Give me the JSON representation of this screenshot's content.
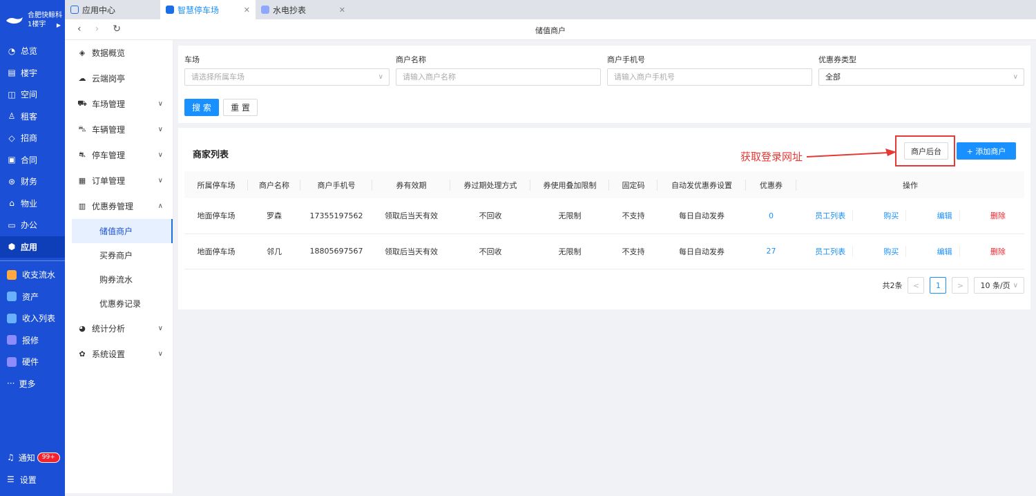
{
  "brand": {
    "line1": "合肥快鲸科",
    "line2": "1楼宇"
  },
  "left_nav": [
    {
      "label": "总览",
      "icon": "◔"
    },
    {
      "label": "楼宇",
      "icon": "▤"
    },
    {
      "label": "空间",
      "icon": "◫"
    },
    {
      "label": "租客",
      "icon": "♙"
    },
    {
      "label": "招商",
      "icon": "◇"
    },
    {
      "label": "合同",
      "icon": "▣"
    },
    {
      "label": "财务",
      "icon": "⊛"
    },
    {
      "label": "物业",
      "icon": "⌂"
    },
    {
      "label": "办公",
      "icon": "▭"
    },
    {
      "label": "应用",
      "icon": "⬢"
    }
  ],
  "quick_nav": [
    {
      "label": "收支流水",
      "color": "#ffa940"
    },
    {
      "label": "资产",
      "color": "#69b1ff"
    },
    {
      "label": "收入列表",
      "color": "#69b1ff"
    },
    {
      "label": "报修",
      "color": "#8c8cff"
    },
    {
      "label": "硬件",
      "color": "#8c8cff"
    }
  ],
  "more_label": "更多",
  "notify": {
    "label": "通知",
    "badge": "99+"
  },
  "settings_label": "设置",
  "tabs": [
    {
      "label": "应用中心"
    },
    {
      "label": "智慧停车场"
    },
    {
      "label": "水电抄表"
    }
  ],
  "page_title": "储值商户",
  "side_menu": {
    "items_top": [
      {
        "label": "数据概览",
        "icon": "◈"
      },
      {
        "label": "云端岗亭",
        "icon": "☁"
      },
      {
        "label": "车场管理",
        "icon": "⛟"
      },
      {
        "label": "车辆管理",
        "icon": "⛍"
      },
      {
        "label": "停车管理",
        "icon": "⛐"
      },
      {
        "label": "订单管理",
        "icon": "▦"
      },
      {
        "label": "优惠券管理",
        "icon": "▥"
      }
    ],
    "sub_items": [
      "储值商户",
      "买券商户",
      "购券流水",
      "优惠券记录"
    ],
    "items_bottom": [
      {
        "label": "统计分析",
        "icon": "◕"
      },
      {
        "label": "系统设置",
        "icon": "✿"
      }
    ]
  },
  "filter": {
    "lot_label": "车场",
    "lot_placeholder": "请选择所属车场",
    "name_label": "商户名称",
    "name_placeholder": "请输入商户名称",
    "phone_label": "商户手机号",
    "phone_placeholder": "请输入商户手机号",
    "type_label": "优惠券类型",
    "type_value": "全部",
    "search_btn": "搜 索",
    "reset_btn": "重 置"
  },
  "list": {
    "title": "商家列表",
    "annotation": "获取登录网址",
    "backend_btn": "商户后台",
    "add_btn": "+ 添加商户",
    "columns": [
      "所属停车场",
      "商户名称",
      "商户手机号",
      "券有效期",
      "券过期处理方式",
      "券使用叠加限制",
      "固定码",
      "自动发优惠券设置",
      "优惠券",
      "操作"
    ],
    "rows": [
      {
        "lot": "地面停车场",
        "name": "罗森",
        "phone": "17355197562",
        "validity": "领取后当天有效",
        "expire": "不回收",
        "stack": "无限制",
        "fixed": "不支持",
        "auto": "每日自动发券",
        "coupons": "0"
      },
      {
        "lot": "地面停车场",
        "name": "邻几",
        "phone": "18805697567",
        "validity": "领取后当天有效",
        "expire": "不回收",
        "stack": "无限制",
        "fixed": "不支持",
        "auto": "每日自动发券",
        "coupons": "27"
      }
    ],
    "ops": [
      "员工列表",
      "购买",
      "编辑",
      "删除"
    ]
  },
  "pager": {
    "total": "共2条",
    "prev": "<",
    "page": "1",
    "next": ">",
    "size": "10 条/页"
  }
}
